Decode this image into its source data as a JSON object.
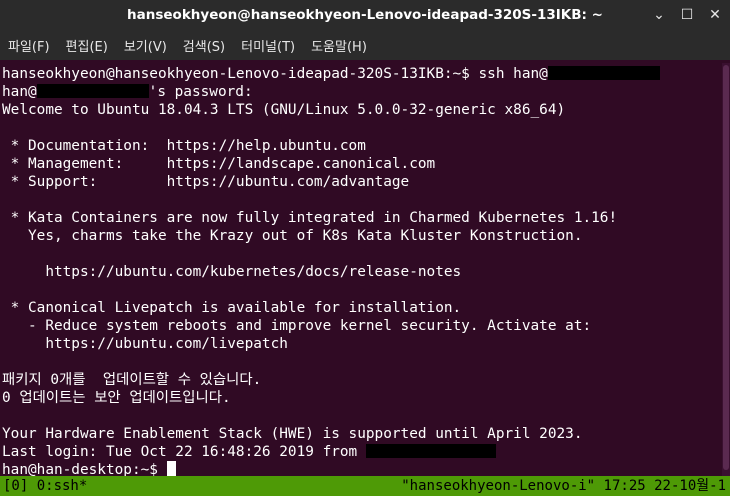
{
  "window": {
    "title": "hanseokhyeon@hanseokhyeon-Lenovo-ideapad-320S-13IKB: ~",
    "controls": {
      "minimize": "⌄",
      "maximize": "☐",
      "close": "✕"
    }
  },
  "menu": [
    "파일(F)",
    "편집(E)",
    "보기(V)",
    "검색(S)",
    "터미널(T)",
    "도움말(H)"
  ],
  "terminal": {
    "lines": [
      "hanseokhyeon@hanseokhyeon-Lenovo-ideapad-320S-13IKB:~$ ssh han@",
      "han@",
      "'s password:",
      "Welcome to Ubuntu 18.04.3 LTS (GNU/Linux 5.0.0-32-generic x86_64)",
      "",
      " * Documentation:  https://help.ubuntu.com",
      " * Management:     https://landscape.canonical.com",
      " * Support:        https://ubuntu.com/advantage",
      "",
      " * Kata Containers are now fully integrated in Charmed Kubernetes 1.16!",
      "   Yes, charms take the Krazy out of K8s Kata Kluster Konstruction.",
      "",
      "     https://ubuntu.com/kubernetes/docs/release-notes",
      "",
      " * Canonical Livepatch is available for installation.",
      "   - Reduce system reboots and improve kernel security. Activate at:",
      "     https://ubuntu.com/livepatch",
      "",
      "패키지 0개를  업데이트할 수 있습니다.",
      "0 업데이트는 보안 업데이트입니다.",
      "",
      "Your Hardware Enablement Stack (HWE) is supported until April 2023.",
      "Last login: Tue Oct 22 16:48:26 2019 from ",
      "han@han-desktop:~$ "
    ]
  },
  "status": {
    "left": "[0] 0:ssh*",
    "right": "\"hanseokhyeon-Lenovo-i\" 17:25 22-10월-1"
  },
  "colors": {
    "terminal_bg": "#300a24",
    "titlebar_bg": "#2b2b2b",
    "status_bg": "#4e9a06",
    "text": "#ffffff"
  }
}
